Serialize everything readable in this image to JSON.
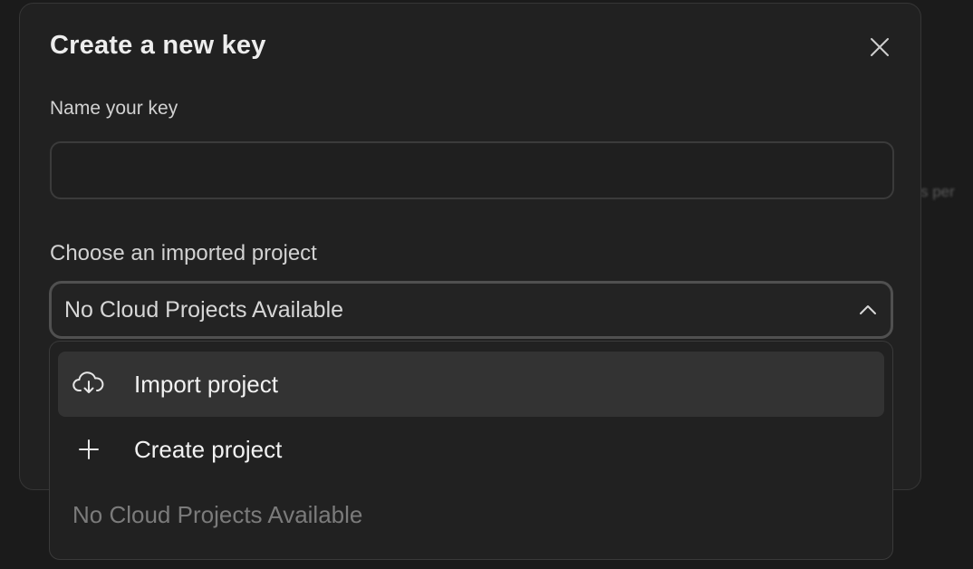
{
  "backdrop": {
    "partial_text": "s per"
  },
  "dialog": {
    "title": "Create a new key",
    "close_icon": "close-icon",
    "name_field": {
      "label": "Name your key",
      "value": "",
      "placeholder": ""
    },
    "project_field": {
      "label": "Choose an imported project",
      "selected_value": "No Cloud Projects Available",
      "chevron_icon": "chevron-up-icon"
    }
  },
  "dropdown": {
    "items": [
      {
        "label": "Import project",
        "icon": "cloud-download-icon",
        "highlighted": true
      },
      {
        "label": "Create project",
        "icon": "plus-icon",
        "highlighted": false
      }
    ],
    "empty_text": "No Cloud Projects Available"
  },
  "colors": {
    "background": "#1b1b1b",
    "dialog_bg": "#212121",
    "highlight": "#333333",
    "muted_text": "#7b7b7b"
  }
}
